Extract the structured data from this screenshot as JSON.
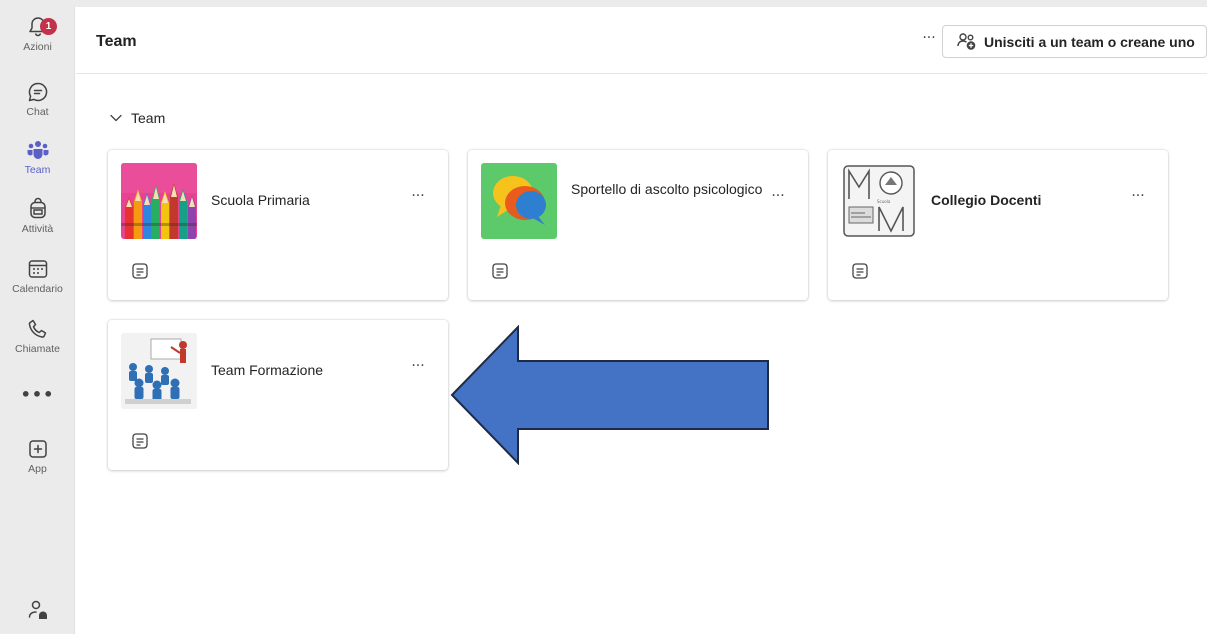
{
  "rail": {
    "items": [
      {
        "label": "Azioni",
        "badge": "1",
        "icon": "bell-icon"
      },
      {
        "label": "Chat",
        "icon": "chat-icon"
      },
      {
        "label": "Team",
        "icon": "teams-icon"
      },
      {
        "label": "Attività",
        "icon": "backpack-icon"
      },
      {
        "label": "Calendario",
        "icon": "calendar-icon"
      },
      {
        "label": "Chiamate",
        "icon": "phone-icon"
      },
      {
        "label": "•••",
        "icon": "more-icon"
      },
      {
        "label": "App",
        "icon": "add-app-icon"
      }
    ],
    "bottom_icon": "person-feedback-icon"
  },
  "header": {
    "title": "Team",
    "more_label": "···",
    "join_button_label": "Unisciti a un team o creane uno"
  },
  "section": {
    "label": "Team"
  },
  "cards": [
    {
      "name": "Scuola Primaria",
      "more": "···",
      "thumbnail": "colored-pencils"
    },
    {
      "name": "Sportello di ascolto psicologico",
      "more": "···",
      "thumbnail": "speech-bubbles"
    },
    {
      "name": "Collegio Docenti",
      "more": "···",
      "thumbnail": "school-emblem"
    },
    {
      "name": "Team Formazione",
      "more": "···",
      "thumbnail": "classroom-figures"
    }
  ],
  "annotation": {
    "arrow_color": "#4472c4",
    "points_to": "Team Formazione"
  },
  "colors": {
    "accent": "#5b5fc7",
    "badge": "#c4314b",
    "rail_bg": "#ebebeb"
  }
}
